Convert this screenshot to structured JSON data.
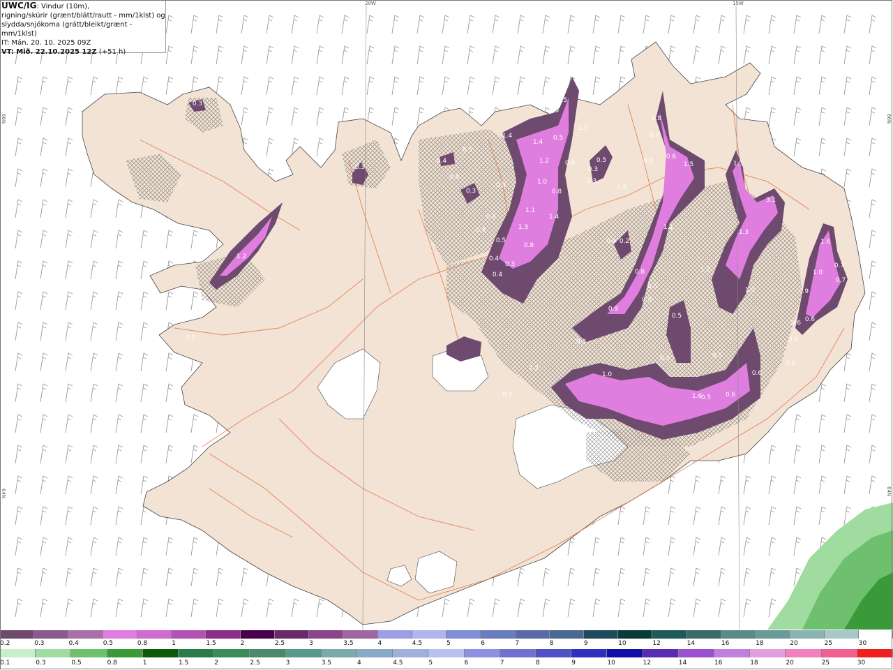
{
  "header": {
    "title": "UWC/IG",
    "line1_rest": ": Vindur (10m),",
    "line2": "rigning/skúrir (grænt/blátt/rautt - mm/1klst) og",
    "line3": "slydda/snjókoma (grátt/bleikt/grænt - mm/1klst)",
    "it_label": "IT:",
    "it_value": "Mán. 20. 10. 2025 09Z",
    "vt_label": "VT:",
    "vt_value": "Mið. 22.10.2025 12Z",
    "vt_offset": "(+51 h)"
  },
  "grid_labels": {
    "lon_20w": "20W",
    "lon_15w": "15W",
    "lat_66n_left": "66N",
    "lat_66n_right": "66N",
    "lat_64n_left": "64N",
    "lat_64n_right": "64N"
  },
  "precip_values": [
    {
      "text": "0.3"
    },
    {
      "text": "0.3"
    },
    {
      "text": "1.2"
    },
    {
      "text": "0.2"
    },
    {
      "text": "0.4"
    },
    {
      "text": "0.5"
    },
    {
      "text": "0.4"
    },
    {
      "text": "0.3"
    },
    {
      "text": "0.5"
    },
    {
      "text": "0.6"
    },
    {
      "text": "0.4"
    },
    {
      "text": "0.5"
    },
    {
      "text": "0.4"
    },
    {
      "text": "0.3"
    },
    {
      "text": "0.4"
    },
    {
      "text": "1.1"
    },
    {
      "text": "1.3"
    },
    {
      "text": "0.8"
    },
    {
      "text": "1.0"
    },
    {
      "text": "1.4"
    },
    {
      "text": "1.2"
    },
    {
      "text": "1.5"
    },
    {
      "text": "1.4"
    },
    {
      "text": "1.5"
    },
    {
      "text": "0.8"
    },
    {
      "text": "1.4"
    },
    {
      "text": "0.9"
    },
    {
      "text": "0.5"
    },
    {
      "text": "0.5"
    },
    {
      "text": "0.3"
    },
    {
      "text": "0.3"
    },
    {
      "text": "0.2"
    },
    {
      "text": "0.4"
    },
    {
      "text": "0.2"
    },
    {
      "text": "0.8"
    },
    {
      "text": "0.7"
    },
    {
      "text": "0.8"
    },
    {
      "text": "0.6"
    },
    {
      "text": "1.5"
    },
    {
      "text": "1.1"
    },
    {
      "text": "0.8"
    },
    {
      "text": "0.5"
    },
    {
      "text": "0.3"
    },
    {
      "text": "0.9"
    },
    {
      "text": "1.3"
    },
    {
      "text": "1.3"
    },
    {
      "text": "3.1"
    },
    {
      "text": "1.2"
    },
    {
      "text": "1.0"
    },
    {
      "text": "1.6"
    },
    {
      "text": "1.0"
    },
    {
      "text": "0.7"
    },
    {
      "text": "0.7"
    },
    {
      "text": "0.9"
    },
    {
      "text": "0.6"
    },
    {
      "text": "0.6"
    },
    {
      "text": "0.6"
    },
    {
      "text": "0.3"
    },
    {
      "text": "0.5"
    },
    {
      "text": "0.3"
    },
    {
      "text": "0.5"
    },
    {
      "text": "0.3"
    },
    {
      "text": "1.0"
    },
    {
      "text": "0.7"
    },
    {
      "text": "0.5"
    },
    {
      "text": "1.6"
    },
    {
      "text": "0.6"
    },
    {
      "text": "0.6"
    },
    {
      "text": "0.2"
    }
  ],
  "legend_snow": {
    "labels": [
      "0.2",
      "0.3",
      "0.4",
      "0.5",
      "0.8",
      "1",
      "1.5",
      "2",
      "2.5",
      "3",
      "3.5",
      "4",
      "4.5",
      "5",
      "6",
      "7",
      "8",
      "9",
      "10",
      "12",
      "14",
      "16",
      "18",
      "20",
      "25",
      "30"
    ],
    "colors": [
      "#6e4a6e",
      "#8a5a8a",
      "#a870a8",
      "#e07ee0",
      "#cf6acf",
      "#b352b3",
      "#8a2f8a",
      "#4a004a",
      "#6a2a6a",
      "#8a458a",
      "#a066a0",
      "#9e9ee6",
      "#b3b3f0",
      "#7f8fd6",
      "#6a7cc0",
      "#5a6aa8",
      "#4a6890",
      "#1f4a5a",
      "#0a3a3a",
      "#1f5a5a",
      "#3a6a6a",
      "#5a8a8a",
      "#6a9a9a",
      "#8ab3b3",
      "#a8c8c8",
      "#ffffff"
    ]
  },
  "legend_rain": {
    "labels": [
      "0.1",
      "0.3",
      "0.5",
      "0.8",
      "1",
      "1.5",
      "2",
      "2.5",
      "3",
      "3.5",
      "4",
      "4.5",
      "5",
      "6",
      "7",
      "8",
      "9",
      "10",
      "12",
      "14",
      "16",
      "18",
      "20",
      "25",
      "30"
    ],
    "colors": [
      "#c8f0c8",
      "#a0dca0",
      "#6ec06e",
      "#3a9a3a",
      "#0a5a0a",
      "#2a7a4a",
      "#3a8a5a",
      "#4a8a6a",
      "#5a9a8a",
      "#7aaaaa",
      "#8aaac8",
      "#a0b0dc",
      "#b8c0f0",
      "#9090e0",
      "#7070d0",
      "#5050c8",
      "#3030c0",
      "#1010a8",
      "#5a2ab0",
      "#9a50d0",
      "#c080e0",
      "#e0a0e0",
      "#f080c0",
      "#f06090",
      "#f02020"
    ]
  }
}
